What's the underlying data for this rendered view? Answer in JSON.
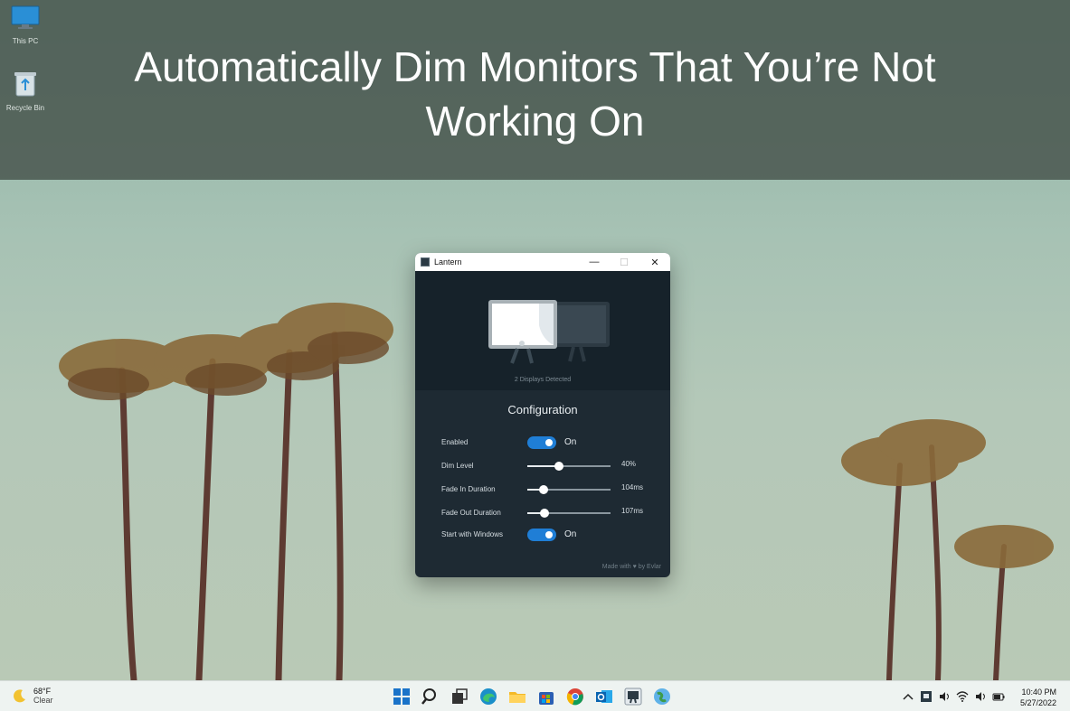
{
  "banner": {
    "title": "Automatically Dim Monitors That You’re Not Working On"
  },
  "desktop_icons": [
    {
      "label": "This PC",
      "icon": "monitor-icon"
    },
    {
      "label": "Recycle Bin",
      "icon": "recycle-bin-icon"
    }
  ],
  "window": {
    "title": "Lantern",
    "controls": {
      "minimize": "—",
      "maximize": "☐",
      "close": "✕"
    }
  },
  "hero": {
    "status": "2 Displays Detected"
  },
  "config": {
    "title": "Configuration",
    "enabled": {
      "label": "Enabled",
      "state": "On"
    },
    "dim_level": {
      "label": "Dim Level",
      "value": "40%",
      "fraction": 0.38
    },
    "fade_in": {
      "label": "Fade In Duration",
      "value": "104ms",
      "fraction": 0.2
    },
    "fade_out": {
      "label": "Fade Out Duration",
      "value": "107ms",
      "fraction": 0.21
    },
    "start_with_windows": {
      "label": "Start with Windows",
      "state": "On"
    },
    "footer": {
      "prefix": "Made with",
      "heart": "♥",
      "suffix": "by Evlar"
    }
  },
  "taskbar": {
    "weather": {
      "temp": "68°F",
      "condition": "Clear"
    },
    "apps": [
      "start-icon",
      "search-icon",
      "task-view-icon",
      "edge-icon",
      "file-explorer-icon",
      "store-icon",
      "chrome-icon",
      "outlook-icon",
      "lantern-icon",
      "network-globe-icon"
    ],
    "clock": {
      "time": "10:40 PM",
      "date": "5/27/2022"
    }
  },
  "colors": {
    "accent": "#1f7ed6",
    "window_bg": "#1e2a33",
    "hero_bg": "#16222a"
  }
}
